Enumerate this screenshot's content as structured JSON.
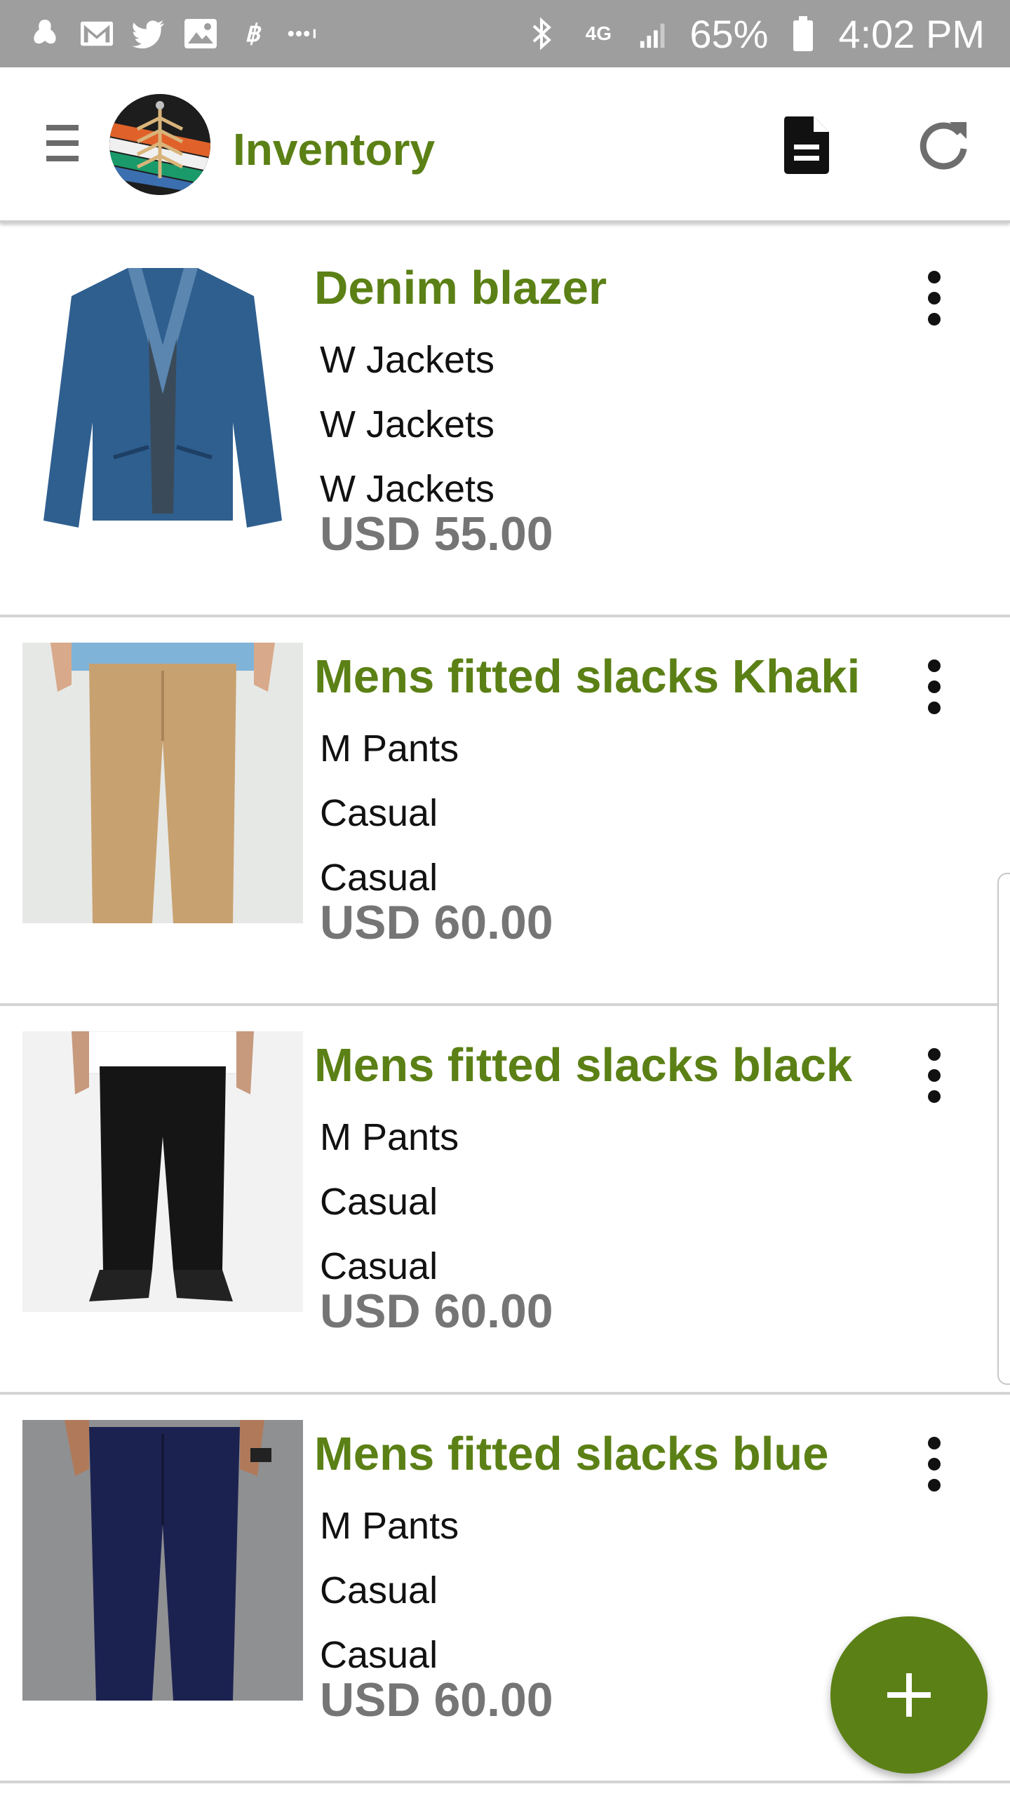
{
  "status_bar": {
    "battery_percent": "65%",
    "time": "4:02 PM",
    "network": "4G",
    "left_icons": [
      "notification-app-icon",
      "gmail-icon",
      "twitter-icon",
      "gallery-icon",
      "bitcoin-icon",
      "more-notifications-icon"
    ],
    "right_icons": [
      "bluetooth-icon",
      "network-4g-icon",
      "signal-icon",
      "battery-icon"
    ]
  },
  "app_bar": {
    "title": "Inventory",
    "icons": [
      "menu-icon",
      "app-logo",
      "document-icon",
      "refresh-icon"
    ]
  },
  "items": [
    {
      "name": "Denim blazer",
      "line1": "W Jackets",
      "line2": "W Jackets",
      "line3": "W Jackets",
      "price": "USD 55.00",
      "image": "denim-jacket-image"
    },
    {
      "name": "Mens fitted slacks Khaki",
      "line1": "M Pants",
      "line2": "Casual",
      "line3": "Casual",
      "price": "USD 60.00",
      "image": "khaki-pants-image"
    },
    {
      "name": "Mens fitted slacks black",
      "line1": "M Pants",
      "line2": "Casual",
      "line3": "Casual",
      "price": "USD 60.00",
      "image": "black-pants-image"
    },
    {
      "name": "Mens fitted slacks blue",
      "line1": "M Pants",
      "line2": "Casual",
      "line3": "Casual",
      "price": "USD 60.00",
      "image": "blue-pants-image"
    }
  ],
  "fab": {
    "icon": "add-icon"
  },
  "colors": {
    "accent": "#5b8015",
    "price_gray": "#757575",
    "status_bar": "#9e9e9e",
    "fab": "#5b8015"
  }
}
